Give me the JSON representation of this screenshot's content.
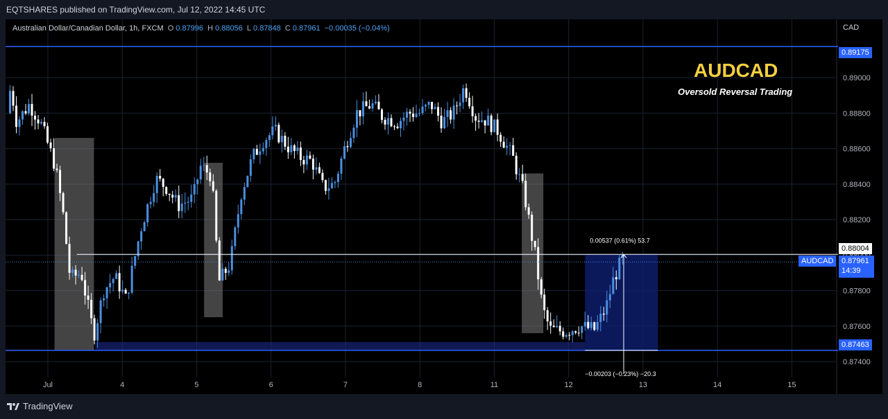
{
  "header": {
    "publish_text": "EQTSHARES published on TradingView.com, Jul 12, 2022 14:45 UTC"
  },
  "legend": {
    "symbol": "Australian Dollar/Canadian Dollar, 1h, FXCM",
    "o_label": "O",
    "o": "0.87996",
    "h_label": "H",
    "h": "0.88056",
    "l_label": "L",
    "l": "0.87848",
    "c_label": "C",
    "c": "0.87961",
    "change": "−0.00035 (−0.04%)"
  },
  "axis": {
    "currency": "CAD"
  },
  "annotations": {
    "title": "AUDCAD",
    "subtitle": "Oversold Reversal Trading",
    "measure_up": "0.00537 (0.61%) 53.7",
    "measure_down": "−0.00203 (−0.23%) −20.3"
  },
  "price_tags": {
    "resistance": "0.89175",
    "measure_top": "0.88004",
    "symbol_label": "AUDCAD",
    "last_price": "0.87961",
    "countdown": "14:39",
    "support": "0.87463"
  },
  "footer": {
    "brand": "TradingView"
  },
  "colors": {
    "up": "#4a8fe0",
    "down": "#ffffff",
    "level_line": "#2962ff",
    "title": "#f4d03f",
    "background": "#000000"
  },
  "chart_data": {
    "type": "candlestick",
    "symbol": "AUDCAD",
    "interval": "1h",
    "ylim": [
      0.8733,
      0.8925
    ],
    "y_ticks": [
      "0.87400",
      "0.87600",
      "0.87800",
      "0.88000",
      "0.88200",
      "0.88400",
      "0.88600",
      "0.88800",
      "0.89000"
    ],
    "y_tick_values": [
      0.874,
      0.876,
      0.878,
      0.88,
      0.882,
      0.884,
      0.886,
      0.888,
      0.89
    ],
    "x_ticks": [
      "Jul",
      "4",
      "5",
      "6",
      "7",
      "8",
      "11",
      "12",
      "13",
      "14",
      "15"
    ],
    "x_tick_slots": [
      0,
      1,
      2,
      3,
      4,
      5,
      6,
      7,
      8,
      9,
      10
    ],
    "xlim_slots": [
      -0.55,
      10.5
    ],
    "horizontal_levels": [
      {
        "name": "resistance",
        "price": 0.89175
      },
      {
        "name": "support",
        "price": 0.87463
      }
    ],
    "current_price": 0.87961,
    "highlight_zones": [
      {
        "from": 0.09,
        "to": 0.62,
        "low": 0.87463,
        "high": 0.8866
      },
      {
        "from": 2.1,
        "to": 2.35,
        "low": 0.8765,
        "high": 0.8852
      },
      {
        "from": 6.37,
        "to": 6.66,
        "low": 0.8756,
        "high": 0.8846
      }
    ],
    "support_zone": {
      "from": 0.64,
      "to": 7.22,
      "low": 0.87463,
      "high": 0.8751
    },
    "measure_box": {
      "from": 7.22,
      "to": 8.2,
      "low": 0.87463,
      "high": 0.88004
    },
    "measure_line": {
      "from": 0.39,
      "to": 8.2,
      "price": 0.88004
    },
    "measure_arrow_x": 7.74,
    "closes_anchor": [
      [
        -0.55,
        0.888
      ],
      [
        -0.5,
        0.8895
      ],
      [
        -0.42,
        0.8875
      ],
      [
        -0.25,
        0.8885
      ],
      [
        -0.1,
        0.8875
      ],
      [
        0.1,
        0.885
      ],
      [
        0.2,
        0.8825
      ],
      [
        0.3,
        0.8787
      ],
      [
        0.45,
        0.879
      ],
      [
        0.52,
        0.8775
      ],
      [
        0.62,
        0.8755
      ],
      [
        0.75,
        0.878
      ],
      [
        0.9,
        0.8788
      ],
      [
        1.05,
        0.8775
      ],
      [
        1.25,
        0.8815
      ],
      [
        1.45,
        0.8843
      ],
      [
        1.6,
        0.8838
      ],
      [
        1.75,
        0.8828
      ],
      [
        1.95,
        0.8832
      ],
      [
        2.05,
        0.885
      ],
      [
        2.2,
        0.8845
      ],
      [
        2.3,
        0.8785
      ],
      [
        2.45,
        0.8795
      ],
      [
        2.6,
        0.8835
      ],
      [
        2.75,
        0.8855
      ],
      [
        2.9,
        0.8865
      ],
      [
        3.05,
        0.887
      ],
      [
        3.15,
        0.8865
      ],
      [
        3.25,
        0.886
      ],
      [
        3.4,
        0.8855
      ],
      [
        3.55,
        0.8853
      ],
      [
        3.7,
        0.8838
      ],
      [
        3.85,
        0.884
      ],
      [
        4.0,
        0.8862
      ],
      [
        4.15,
        0.888
      ],
      [
        4.35,
        0.8885
      ],
      [
        4.5,
        0.8878
      ],
      [
        4.7,
        0.8875
      ],
      [
        4.85,
        0.888
      ],
      [
        5.0,
        0.888
      ],
      [
        5.15,
        0.8885
      ],
      [
        5.3,
        0.8875
      ],
      [
        5.45,
        0.888
      ],
      [
        5.6,
        0.8895
      ],
      [
        5.75,
        0.8878
      ],
      [
        5.9,
        0.8876
      ],
      [
        6.05,
        0.887
      ],
      [
        6.25,
        0.8855
      ],
      [
        6.4,
        0.8835
      ],
      [
        6.55,
        0.88
      ],
      [
        6.65,
        0.877
      ],
      [
        6.75,
        0.8758
      ],
      [
        6.95,
        0.8757
      ],
      [
        7.15,
        0.876
      ],
      [
        7.35,
        0.8758
      ],
      [
        7.5,
        0.877
      ],
      [
        7.6,
        0.8786
      ],
      [
        7.72,
        0.8798
      ],
      [
        7.74,
        0.87961
      ]
    ]
  }
}
